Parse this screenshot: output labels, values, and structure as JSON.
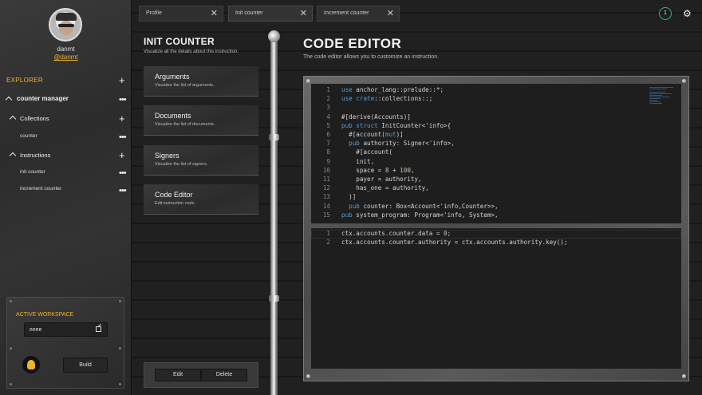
{
  "user": {
    "name": "danmt",
    "handle": "@danmt"
  },
  "explorer": {
    "title": "EXPLORER",
    "application": "counter manager",
    "collections_label": "Collections",
    "collection_items": [
      "counter"
    ],
    "instructions_label": "Instructions",
    "instruction_items": [
      "init counter",
      "increment counter"
    ]
  },
  "workspace": {
    "title": "ACTIVE WORKSPACE",
    "name": "eeee",
    "build_label": "Build"
  },
  "tabs": [
    {
      "label": "Profile"
    },
    {
      "label": "Init counter"
    },
    {
      "label": "Increment counter"
    }
  ],
  "notifications": {
    "count": "1"
  },
  "instruction_panel": {
    "title": "INIT COUNTER",
    "subtitle": "Visualize all the details about this instruction.",
    "cards": [
      {
        "title": "Arguments",
        "subtitle": "Visualize the list of arguments."
      },
      {
        "title": "Documents",
        "subtitle": "Visualize the list of documents."
      },
      {
        "title": "Signers",
        "subtitle": "Visualize the list of signers."
      },
      {
        "title": "Code Editor",
        "subtitle": "Edit instruction code."
      }
    ],
    "edit_label": "Edit",
    "delete_label": "Delete"
  },
  "code_editor": {
    "title": "CODE EDITOR",
    "subtitle": "The code editor allows you to customize an instruction.",
    "context_code": [
      "use anchor_lang::prelude::*;",
      "use crate::collections::;",
      "",
      "#[derive(Accounts)]",
      "pub struct InitCounter<'info>{",
      "  #[account(mut)]",
      "  pub authority: Signer<'info>,",
      "    #[account(",
      "    init,",
      "    space = 8 + 100,",
      "    payer = authority,",
      "    has_one = authority,",
      "  )]",
      "  pub counter: Box<Account<'info,Counter>>,",
      "pub system_program: Program<'info, System>,"
    ],
    "handler_code": [
      "ctx.accounts.counter.data = 0;",
      "ctx.accounts.counter.authority = ctx.accounts.authority.key();"
    ]
  },
  "colors": {
    "accent": "#f0b429",
    "badge_ring": "#2dbb7a",
    "keyword": "#569cd6"
  },
  "icons": [
    "plus-icon",
    "more-icon",
    "caret-icon",
    "external-link-icon",
    "close-icon",
    "gear-icon",
    "logo-icon"
  ]
}
